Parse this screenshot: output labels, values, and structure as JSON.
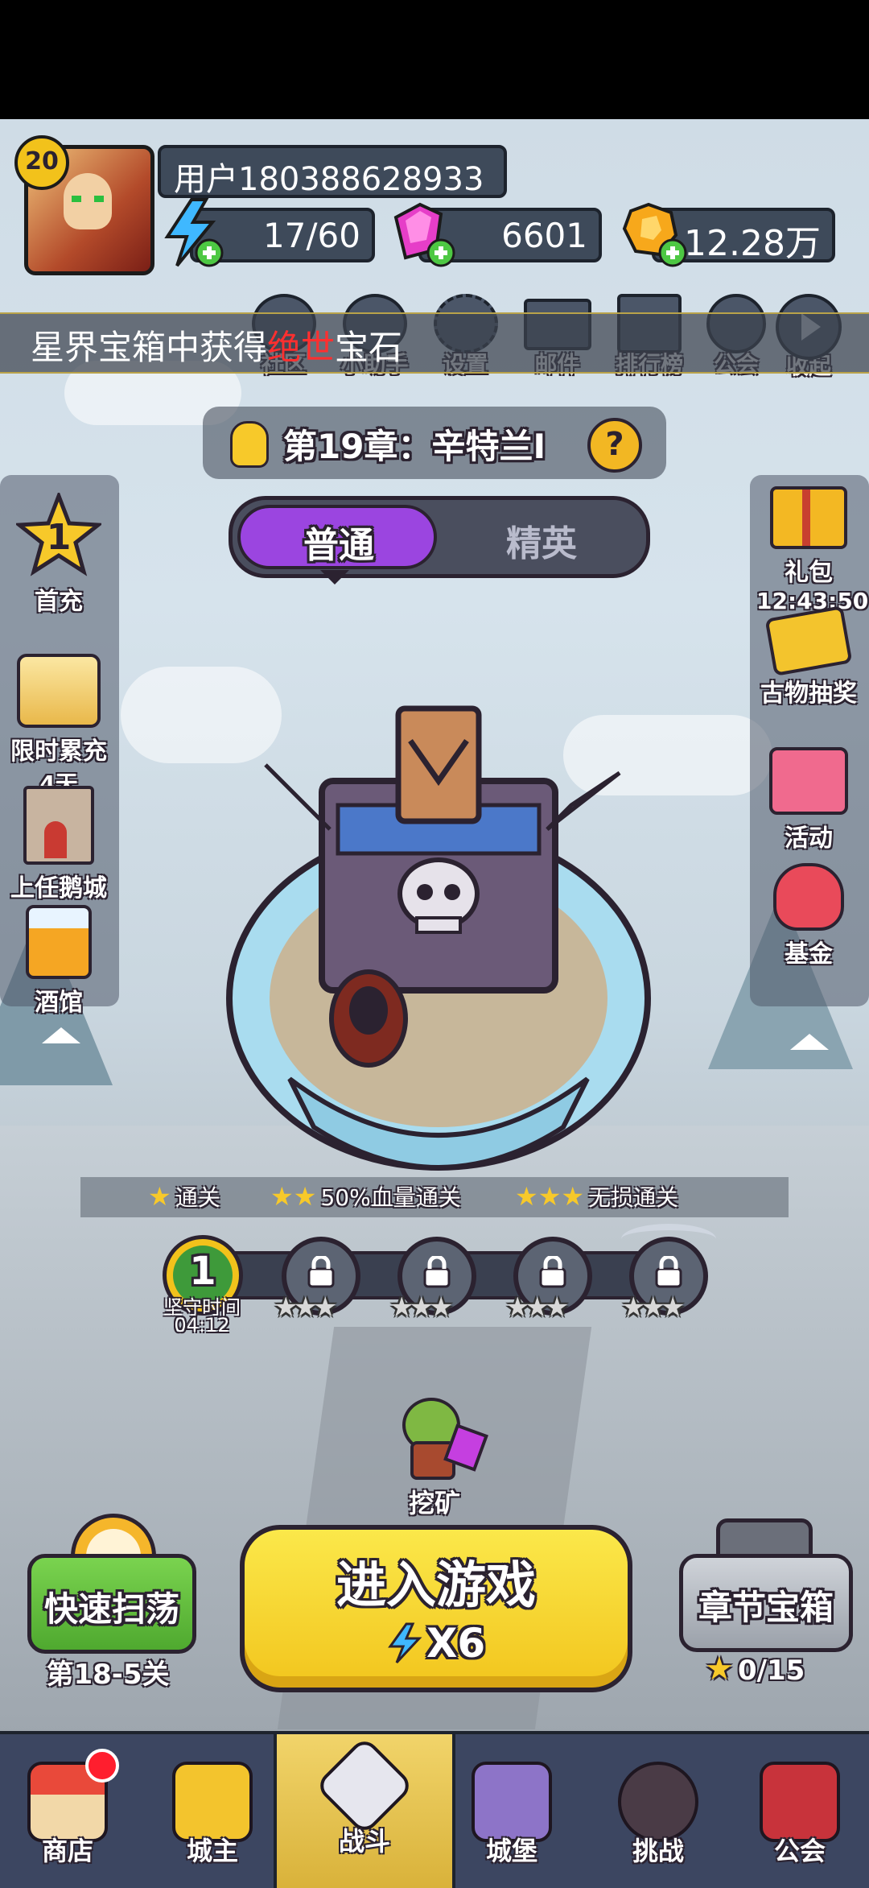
{
  "player": {
    "level": "20",
    "name": "用户180388628933",
    "energy": "17/60",
    "gems": "6601",
    "gold": "12.28万"
  },
  "ticker": {
    "part1": "星界宝箱中获得",
    "highlight": "绝世",
    "part2": "宝石"
  },
  "top_menu": [
    "社区",
    "小助手",
    "设置",
    "邮件",
    "排行榜",
    "公会",
    "收起"
  ],
  "chapter": {
    "title": "第19章：辛特兰Ⅰ",
    "help": "?"
  },
  "difficulty_tabs": {
    "normal": "普通",
    "elite": "精英"
  },
  "left_sidebar": {
    "first_charge_rank": "1",
    "first_charge": "首充",
    "limited_recharge": "限时累充",
    "limited_recharge_days": "4天",
    "goose_city": "上任鹅城",
    "tavern": "酒馆"
  },
  "right_sidebar": {
    "gift": "礼包",
    "gift_timer": "12:43:50",
    "relic_draw": "古物抽奖",
    "event": "活动",
    "fund": "基金"
  },
  "star_conditions": {
    "one": "通关",
    "two": "50%血量通关",
    "three": "无损通关"
  },
  "stage_track": {
    "current_stage": "1",
    "current_label": "坚守时间",
    "current_time": "04:12"
  },
  "mining": "挖矿",
  "quick_sweep": {
    "label": "快速扫荡",
    "progress": "第18-5关"
  },
  "enter_game": {
    "label": "进入游戏",
    "cost": "X6"
  },
  "chapter_chest": {
    "label": "章节宝箱",
    "stars": "0/15"
  },
  "bottom_nav": [
    "商店",
    "城主",
    "战斗",
    "城堡",
    "挑战",
    "公会"
  ],
  "colors": {
    "accent_purple": "#9b45e0",
    "enter_yellow": "#f6d92a",
    "sweep_green": "#5fc43c",
    "nav_bg": "#3c4661",
    "nav_active": "#e7c247"
  }
}
